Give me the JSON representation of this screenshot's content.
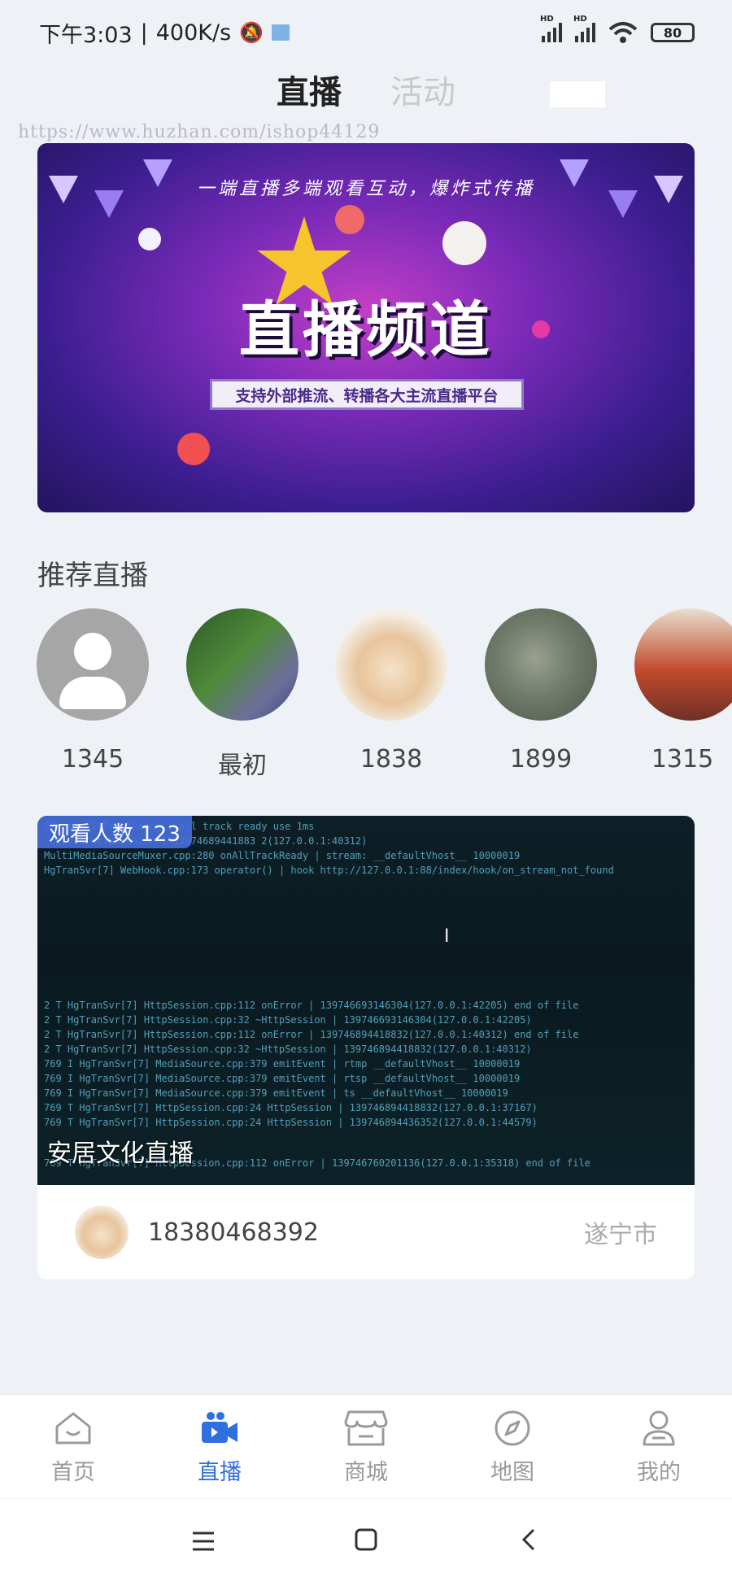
{
  "status_bar": {
    "time": "下午3:03",
    "speed": "400K/s",
    "hd1": "HD",
    "hd2": "HD",
    "battery": "80"
  },
  "top_tabs": {
    "active": "直播",
    "inactive": "活动"
  },
  "watermark": "https://www.huzhan.com/ishop44129",
  "banner": {
    "slogan": "一端直播多端观看互动，爆炸式传播",
    "title": "直播频道",
    "subtitle": "支持外部推流、转播各大主流直播平台"
  },
  "recommended": {
    "title": "推荐直播",
    "anchors": [
      {
        "name": "1345"
      },
      {
        "name": "最初"
      },
      {
        "name": "1838"
      },
      {
        "name": "1899"
      },
      {
        "name": "1315"
      }
    ]
  },
  "live_card": {
    "viewers": "观看人数 123",
    "title": "安居文化直播",
    "owner_phone": "18380468392",
    "city": "遂宁市"
  },
  "bottom_nav": {
    "items": [
      {
        "label": "首页",
        "icon": "home-icon"
      },
      {
        "label": "直播",
        "icon": "live-camera-icon"
      },
      {
        "label": "商城",
        "icon": "store-icon"
      },
      {
        "label": "地图",
        "icon": "compass-icon"
      },
      {
        "label": "我的",
        "icon": "profile-icon"
      }
    ],
    "active_color": "#2f6fe0",
    "inactive_color": "#9a9a9a"
  }
}
